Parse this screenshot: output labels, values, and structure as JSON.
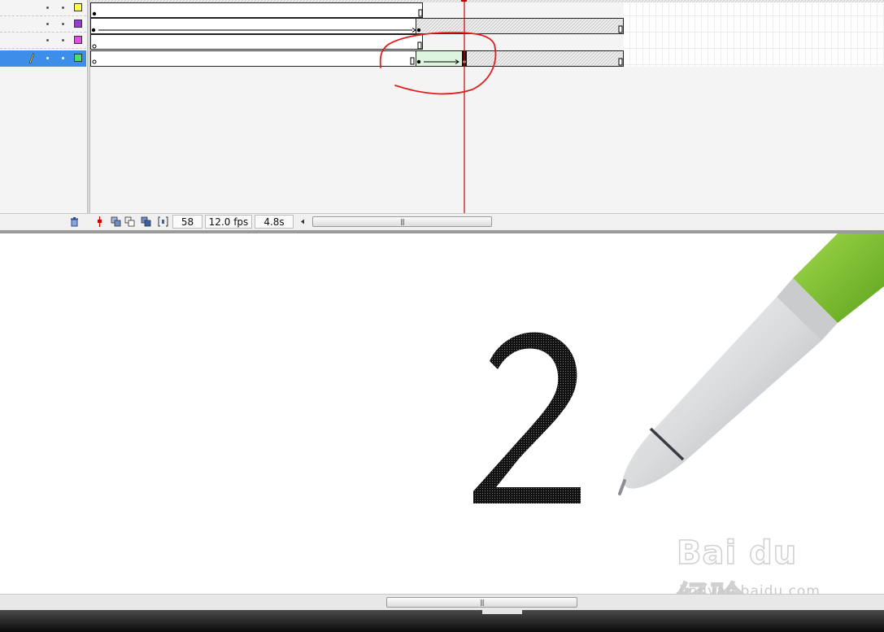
{
  "timeline": {
    "layers": [
      {
        "color": "#ffff4d",
        "selected": false
      },
      {
        "color": "#9b3ad3",
        "selected": false
      },
      {
        "color": "#e24de2",
        "selected": false
      },
      {
        "color": "#4ddd6b",
        "selected": true
      }
    ],
    "current_frame": "58",
    "frame_rate": "12.0 fps",
    "elapsed_time": "4.8s"
  },
  "stage": {
    "character": "2"
  },
  "watermark": {
    "logo": "Bai du 经验",
    "url": "jingyan.baidu.com"
  },
  "icons": {
    "trash": "trash-icon",
    "pencil": "pencil-icon",
    "playhead": "playhead-icon",
    "onion_skin": "onion-skin-icon",
    "onion_outline": "onion-skin-outline-icon",
    "edit_multiple": "edit-multiple-frames-icon",
    "onion_markers": "onion-markers-icon",
    "scroll_left": "scroll-left-arrow-icon",
    "pen": "pen-illustration"
  },
  "colors": {
    "selection": "#3d8ee8",
    "playhead": "#cc0000",
    "annotation": "#e02020",
    "tween": "#ddf5dd",
    "pen_green": "#7cc02a"
  }
}
